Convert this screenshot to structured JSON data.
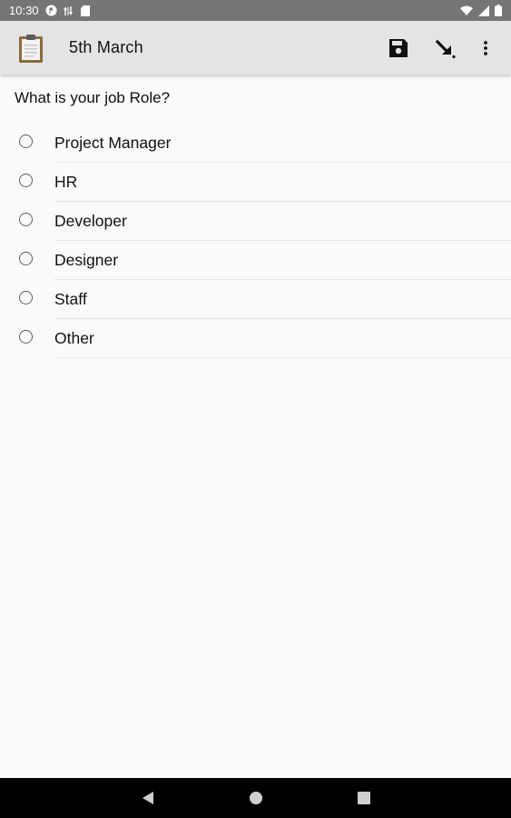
{
  "status_bar": {
    "time": "10:30"
  },
  "app_bar": {
    "title": "5th March"
  },
  "question": {
    "text": "What is your job Role?"
  },
  "options": [
    {
      "label": "Project Manager",
      "selected": false
    },
    {
      "label": "HR",
      "selected": false
    },
    {
      "label": "Developer",
      "selected": false
    },
    {
      "label": "Designer",
      "selected": false
    },
    {
      "label": "Staff",
      "selected": false
    },
    {
      "label": "Other",
      "selected": false
    }
  ],
  "icons": {
    "app_logo": "clipboard-icon",
    "save": "floppy-disk-icon",
    "import": "arrow-down-right-icon",
    "more": "more-vert-icon",
    "nav_back": "back-triangle-icon",
    "nav_home": "home-circle-icon",
    "nav_recents": "recents-square-icon"
  },
  "colors": {
    "status_bar": "#757575",
    "app_bar": "#e4e4e4",
    "background": "#fafafa",
    "nav_bar": "#000000",
    "clipboard": "#8b6a3e"
  }
}
